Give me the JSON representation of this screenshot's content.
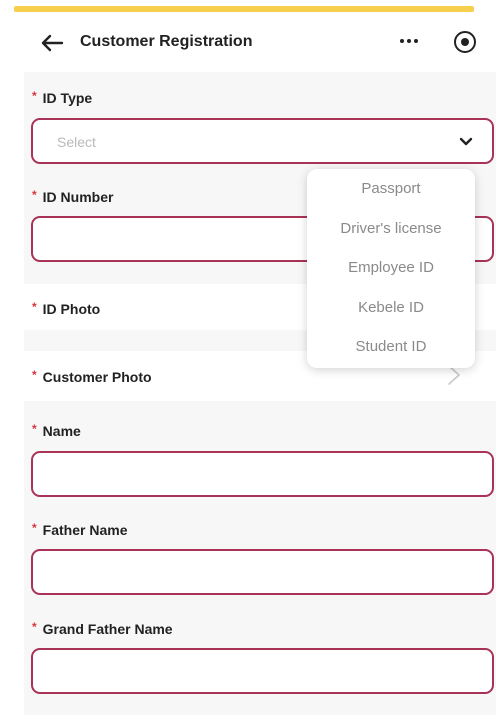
{
  "header": {
    "title": "Customer Registration",
    "back_icon": "arrow-left-icon",
    "more_icon": "more-dots-icon",
    "target_icon": "record-icon"
  },
  "form": {
    "required_mark": "*",
    "id_type": {
      "label": "ID Type",
      "placeholder": "Select"
    },
    "id_number": {
      "label": "ID Number",
      "value": ""
    },
    "id_photo": {
      "label": "ID Photo"
    },
    "customer_photo": {
      "label": "Customer Photo"
    },
    "name": {
      "label": "Name",
      "value": ""
    },
    "father_name": {
      "label": "Father Name",
      "value": ""
    },
    "grand_father_name": {
      "label": "Grand Father Name",
      "value": ""
    }
  },
  "dropdown": {
    "options": [
      "Passport",
      "Driver's license",
      "Employee ID",
      "Kebele ID",
      "Student ID"
    ]
  },
  "colors": {
    "accent_border": "#a83357",
    "required": "#d9343c",
    "top_strip": "#f6cf4d"
  }
}
